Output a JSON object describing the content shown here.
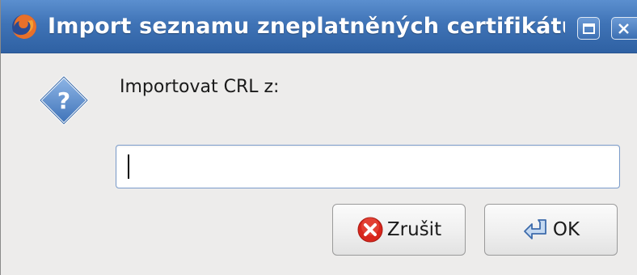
{
  "window": {
    "title": "Import seznamu zneplatněných certifikátů",
    "app_icon": "firefox-icon",
    "controls": [
      "maximize-icon",
      "close-icon"
    ]
  },
  "dialog": {
    "icon": "question-icon",
    "prompt": "Importovat CRL z:",
    "input": {
      "value": "",
      "placeholder": ""
    }
  },
  "buttons": {
    "cancel": {
      "label": "Zrušit",
      "icon": "cancel-icon"
    },
    "ok": {
      "label": "OK",
      "icon": "enter-icon"
    }
  },
  "colors": {
    "titlebar": "#3f73b6",
    "input_border": "#7b9ccb",
    "cancel_icon": "#d8261c",
    "question_icon": "#5b8ed0"
  }
}
